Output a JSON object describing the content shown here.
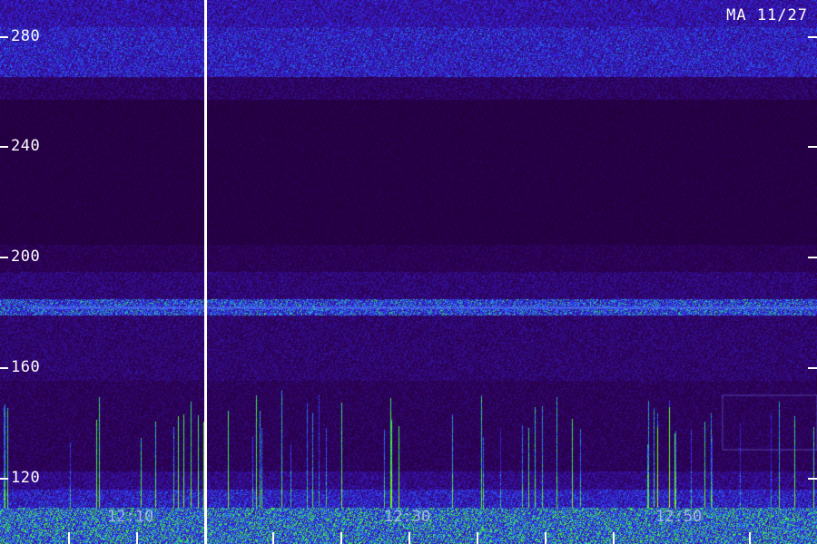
{
  "stamp": "MA 11/27",
  "y_ticks": [
    {
      "label": "280",
      "value": 280
    },
    {
      "label": "240",
      "value": 240
    },
    {
      "label": "200",
      "value": 200
    },
    {
      "label": "160",
      "value": 160
    },
    {
      "label": "120",
      "value": 120
    }
  ],
  "x_labels": [
    "12:10",
    "12:30",
    "12:50"
  ],
  "colors": {
    "background": "#0a0014",
    "base_purple": "#3a0a8a",
    "band_blue": "#2a40ff",
    "hot_green": "#40ff60",
    "cursor": "#ffffff"
  }
}
